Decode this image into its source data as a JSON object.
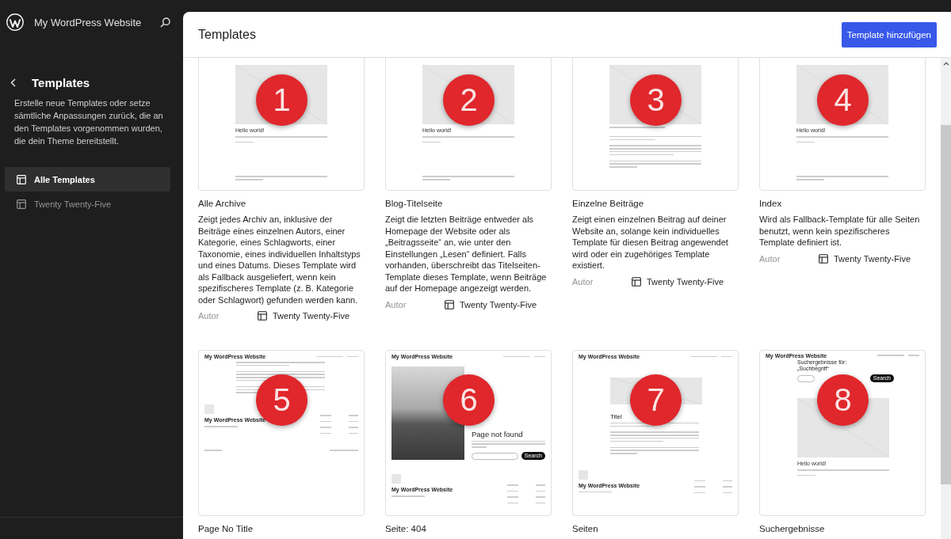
{
  "sidebar": {
    "site_title": "My WordPress Website",
    "title": "Templates",
    "description": "Erstelle neue Templates oder setze sämtliche Anpassungen zurück, die an den Templates vorgenommen wurden, die dein Theme bereitstellt.",
    "items": [
      {
        "label": "Alle Templates",
        "selected": true
      },
      {
        "label": "Twenty Twenty-Five",
        "selected": false
      }
    ]
  },
  "header": {
    "title": "Templates",
    "button": "Template hinzufügen"
  },
  "templates": [
    {
      "title": "Alle Archive",
      "description": "Zeigt jedes Archiv an, inklusive der Beiträge eines einzelnen Autors, einer Kategorie, eines Schlagworts, einer Taxonomie, eines individuellen Inhaltstyps und eines Datums. Dieses Template wird als Fallback ausgeliefert, wenn kein spezifischeres Template (z. B. Kategorie oder Schlagwort) gefunden werden kann.",
      "author_label": "Autor",
      "source": "Twenty Twenty-Five",
      "badge": "1",
      "preview": {
        "kind": "archive",
        "heading": "Hello world!"
      }
    },
    {
      "title": "Blog-Titelseite",
      "description": "Zeigt die letzten Beiträge entweder als Homepage der Website oder als „Beitragsseite“ an, wie unter den Einstellungen „Lesen“ definiert. Falls vorhanden, überschreibt das Titelseiten-Template dieses Template, wenn Beiträge auf der Homepage angezeigt werden.",
      "author_label": "Autor",
      "source": "Twenty Twenty-Five",
      "badge": "2",
      "preview": {
        "kind": "archive",
        "heading": "Hello world!"
      }
    },
    {
      "title": "Einzelne Beiträge",
      "description": "Zeigt einen einzelnen Beitrag auf deiner Website an, solange kein individuelles Template für diesen Beitrag angewendet wird oder ein zugehöriges Template existiert.",
      "author_label": "Autor",
      "source": "Twenty Twenty-Five",
      "badge": "3",
      "preview": {
        "kind": "single"
      }
    },
    {
      "title": "Index",
      "description": "Wird als Fallback-Template für alle Seiten benutzt, wenn kein spezifischeres Template definiert ist.",
      "author_label": "Autor",
      "source": "Twenty Twenty-Five",
      "badge": "4",
      "preview": {
        "kind": "archive",
        "heading": "Hello world!"
      }
    },
    {
      "title": "Page No Title",
      "badge": "5",
      "preview": {
        "kind": "untitled",
        "site_title": "My WordPress Website",
        "footer_title": "My WordPress Website"
      }
    },
    {
      "title": "Seite: 404",
      "badge": "6",
      "preview": {
        "kind": "notfound",
        "site_title": "My WordPress Website",
        "heading": "Page not found",
        "button": "Search",
        "footer_title": "My WordPress Website"
      }
    },
    {
      "title": "Seiten",
      "badge": "7",
      "preview": {
        "kind": "page",
        "site_title": "My WordPress Website",
        "heading": "Titel",
        "footer_title": "My WordPress Website"
      }
    },
    {
      "title": "Suchergebnisse",
      "badge": "8",
      "preview": {
        "kind": "search",
        "site_title": "My WordPress Website",
        "heading": "Suchergebnisse für: „Suchbegriff“",
        "button": "Search",
        "post_title": "Hello world!"
      }
    }
  ]
}
